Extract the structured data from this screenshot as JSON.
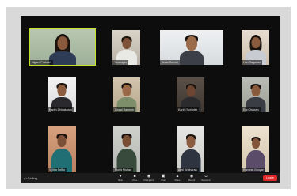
{
  "participants": [
    {
      "name": "Nigam Prakash"
    },
    {
      "name": "Yuvarajan"
    },
    {
      "name": "Anna Gomez"
    },
    {
      "name": "Hari Ragavan"
    },
    {
      "name": "Harith Dhinakaran"
    },
    {
      "name": "Gopal Ramesh"
    },
    {
      "name": "Karthi Surinder"
    },
    {
      "name": "Raj Chawan"
    },
    {
      "name": "Vijitha Sethu"
    },
    {
      "name": "Mohit Nishad"
    },
    {
      "name": "Amil Sridharan"
    },
    {
      "name": "Ramesh Bhuyar"
    }
  ],
  "toolbar": {
    "status": "Ai Calling",
    "items": [
      {
        "icon": "mic-icon",
        "label": "Mute"
      },
      {
        "icon": "video-icon",
        "label": "Video"
      },
      {
        "icon": "people-icon",
        "label": "Participants"
      },
      {
        "icon": "chat-icon",
        "label": "Chat"
      },
      {
        "icon": "share-icon",
        "label": "Share"
      },
      {
        "icon": "record-icon",
        "label": "Record"
      },
      {
        "icon": "reactions-icon",
        "label": "Reactions"
      }
    ],
    "leave_label": "Leave"
  },
  "active_speaker_color": "#c6e02b",
  "leave_color": "#e02828"
}
